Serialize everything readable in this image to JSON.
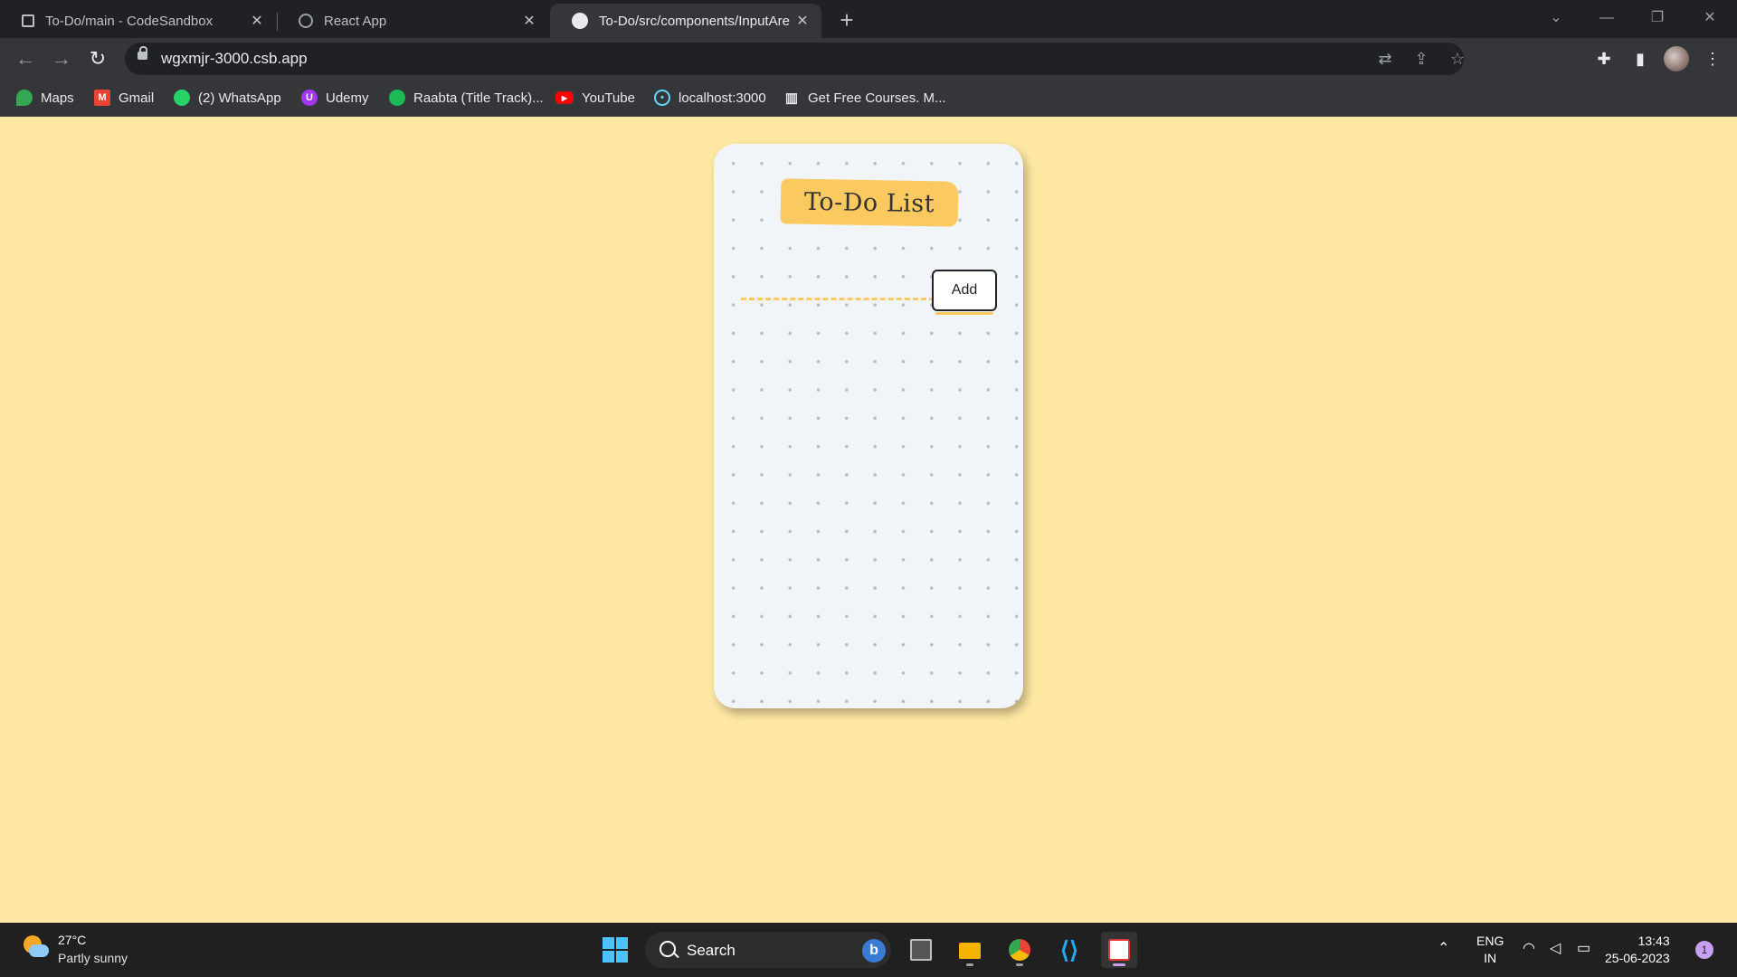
{
  "browser": {
    "tabs": [
      {
        "title": "To-Do/main - CodeSandbox",
        "icon": "codesandbox-icon"
      },
      {
        "title": "React App",
        "icon": "globe-icon"
      },
      {
        "title": "To-Do/src/components/InputAre",
        "icon": "github-icon"
      }
    ],
    "new_tab_label": "+",
    "url": "wgxmjr-3000.csb.app",
    "bookmarks": [
      {
        "label": "Maps",
        "icon": "maps-icon"
      },
      {
        "label": "Gmail",
        "icon": "gmail-icon"
      },
      {
        "label": "(2) WhatsApp",
        "icon": "whatsapp-icon"
      },
      {
        "label": "Udemy",
        "icon": "udemy-icon"
      },
      {
        "label": "Raabta (Title Track)...",
        "icon": "spotify-icon"
      },
      {
        "label": "YouTube",
        "icon": "youtube-icon"
      },
      {
        "label": "localhost:3000",
        "icon": "react-icon"
      },
      {
        "label": "Get Free Courses. M...",
        "icon": "building-icon"
      }
    ]
  },
  "app": {
    "title": "To-Do List",
    "input_value": "",
    "add_button_label": "Add",
    "colors": {
      "page_bg": "#ffe8a3",
      "accent": "#fac95f",
      "card_bg": "#f1f4f8"
    }
  },
  "taskbar": {
    "weather_temp": "27°C",
    "weather_desc": "Partly sunny",
    "search_label": "Search",
    "lang_line1": "ENG",
    "lang_line2": "IN",
    "time": "13:43",
    "date": "25-06-2023",
    "notification_count": "1"
  }
}
